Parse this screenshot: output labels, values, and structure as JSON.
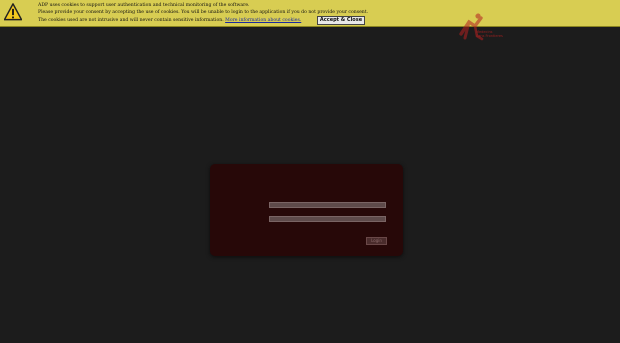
{
  "cookie_banner": {
    "line1": "ADP uses cookies to support user authentication and technical monitoring of the software.",
    "line2": "Please provide your consent by accepting the use of cookies. You will be unable to login to the application if you do not provide your consent.",
    "line3_prefix": "The cookies used are not intrusive and will never contain sensitive information.",
    "more_info_link": "More information about cookies.",
    "accept_button": "Accept & Close",
    "icon": "warning-icon",
    "color": "#d8cd52"
  },
  "logo": {
    "text_line1": "Medecins",
    "text_line2": "Sans Frontieres",
    "icon": "msf-runner-logo"
  },
  "login": {
    "username_placeholder": "",
    "password_placeholder": "",
    "login_button": "Login"
  }
}
